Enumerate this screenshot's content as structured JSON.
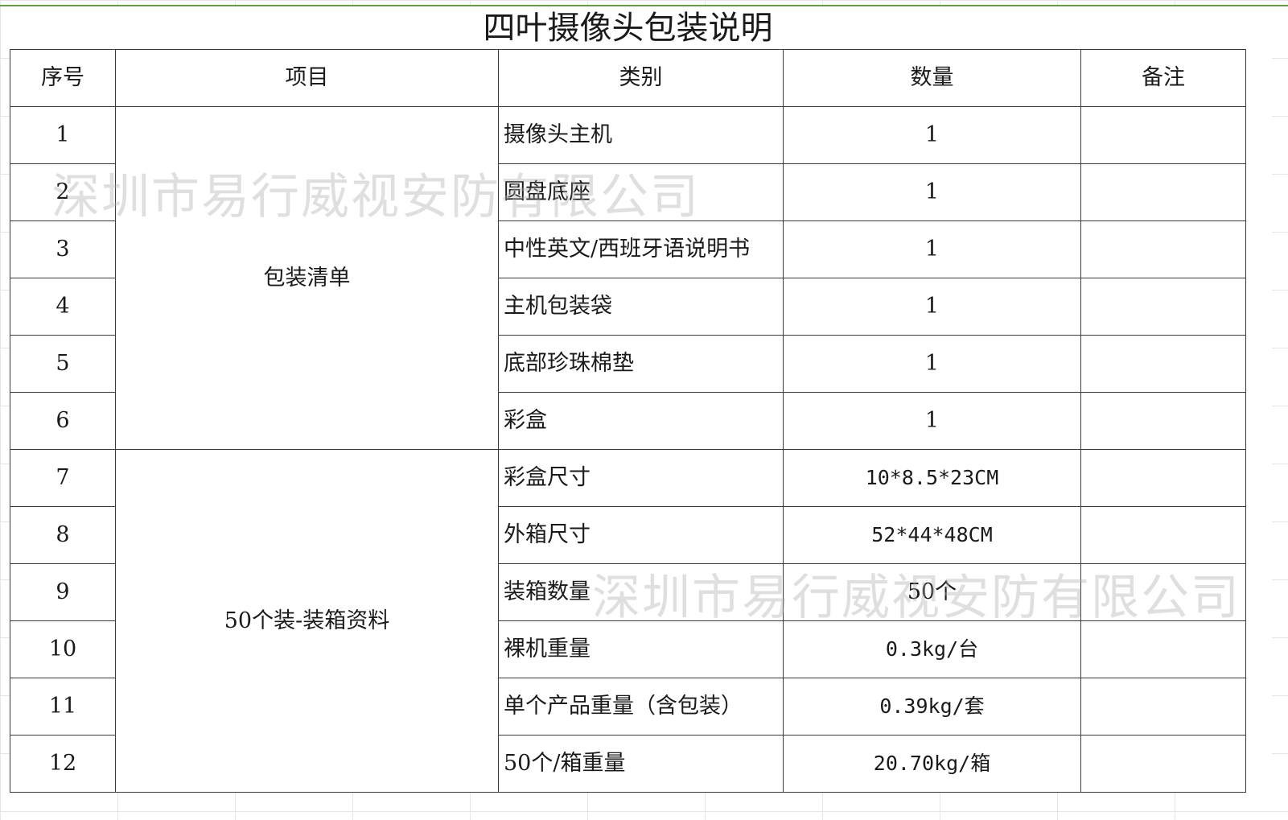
{
  "title": "四叶摄像头包装说明",
  "headers": {
    "index": "序号",
    "item": "项目",
    "category": "类别",
    "quantity": "数量",
    "remark": "备注"
  },
  "groups": [
    {
      "label": "包装清单"
    },
    {
      "label": "50个装-装箱资料"
    }
  ],
  "rows": [
    {
      "index": "1",
      "category": "摄像头主机",
      "quantity": "1",
      "remark": ""
    },
    {
      "index": "2",
      "category": "圆盘底座",
      "quantity": "1",
      "remark": ""
    },
    {
      "index": "3",
      "category": "中性英文/西班牙语说明书",
      "quantity": "1",
      "remark": ""
    },
    {
      "index": "4",
      "category": "主机包装袋",
      "quantity": "1",
      "remark": ""
    },
    {
      "index": "5",
      "category": "底部珍珠棉垫",
      "quantity": "1",
      "remark": ""
    },
    {
      "index": "6",
      "category": "彩盒",
      "quantity": "1",
      "remark": ""
    },
    {
      "index": "7",
      "category": "彩盒尺寸",
      "quantity": "10*8.5*23CM",
      "remark": ""
    },
    {
      "index": "8",
      "category": "外箱尺寸",
      "quantity": "52*44*48CM",
      "remark": ""
    },
    {
      "index": "9",
      "category": "装箱数量",
      "quantity": "50个",
      "remark": ""
    },
    {
      "index": "10",
      "category": "裸机重量",
      "quantity": "0.3kg/台",
      "remark": ""
    },
    {
      "index": "11",
      "category": "单个产品重量（含包装）",
      "quantity": "0.39kg/套",
      "remark": ""
    },
    {
      "index": "12",
      "category": "50个/箱重量",
      "quantity": "20.70kg/箱",
      "remark": ""
    }
  ],
  "watermarks": [
    "深圳市易行威视安防有限公司",
    "深圳市易行威视安防有限公司"
  ]
}
